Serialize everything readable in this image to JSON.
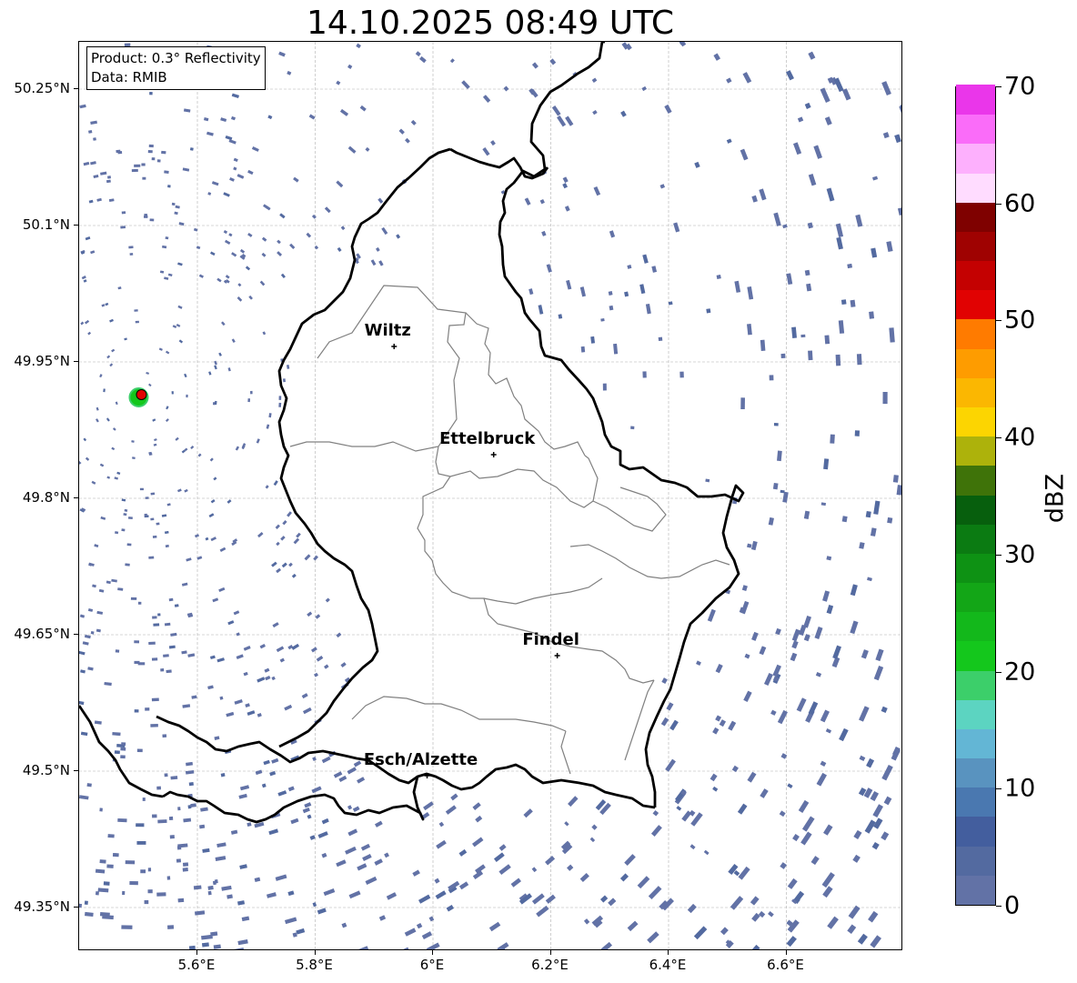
{
  "title": "14.10.2025 08:49 UTC",
  "info": {
    "product": "Product: 0.3° Reflectivity",
    "source": "Data: RMIB"
  },
  "map": {
    "lon_range": [
      5.4,
      6.8
    ],
    "lat_range": [
      49.3,
      50.3
    ],
    "lat_ticks": [
      "50.25°N",
      "50.1°N",
      "49.95°N",
      "49.8°N",
      "49.65°N",
      "49.5°N",
      "49.35°N"
    ],
    "lon_ticks": [
      "5.6°E",
      "5.8°E",
      "6°E",
      "6.2°E",
      "6.4°E",
      "6.6°E"
    ],
    "grid": true,
    "cities": [
      {
        "name": "Wiltz",
        "lon": 5.934,
        "lat": 49.967
      },
      {
        "name": "Ettelbruck",
        "lon": 6.103,
        "lat": 49.848
      },
      {
        "name": "Findel",
        "lon": 6.211,
        "lat": 49.627
      },
      {
        "name": "Esch/Alzette",
        "lon": 5.99,
        "lat": 49.495
      }
    ],
    "radar_site": {
      "lon": 5.505,
      "lat": 49.914
    }
  },
  "colorbar": {
    "unit": "dBZ",
    "min": 0,
    "max": 70,
    "tick_labels": [
      "0",
      "10",
      "20",
      "30",
      "40",
      "50",
      "60",
      "70"
    ],
    "colors": [
      "#6272a6",
      "#536aa0",
      "#435e9e",
      "#4a78b0",
      "#5993bf",
      "#63b6d5",
      "#5cd4c1",
      "#3ccf6a",
      "#14c71c",
      "#13b81b",
      "#13a617",
      "#0e9214",
      "#0b7b12",
      "#075f0d",
      "#3f7309",
      "#adb20b",
      "#fcd501",
      "#fbb701",
      "#fe9c00",
      "#ff7b00",
      "#e10202",
      "#c40101",
      "#9f0201",
      "#7f0100",
      "#ffdcff",
      "#fdb0fd",
      "#fa6cf9",
      "#ea36ea"
    ]
  }
}
